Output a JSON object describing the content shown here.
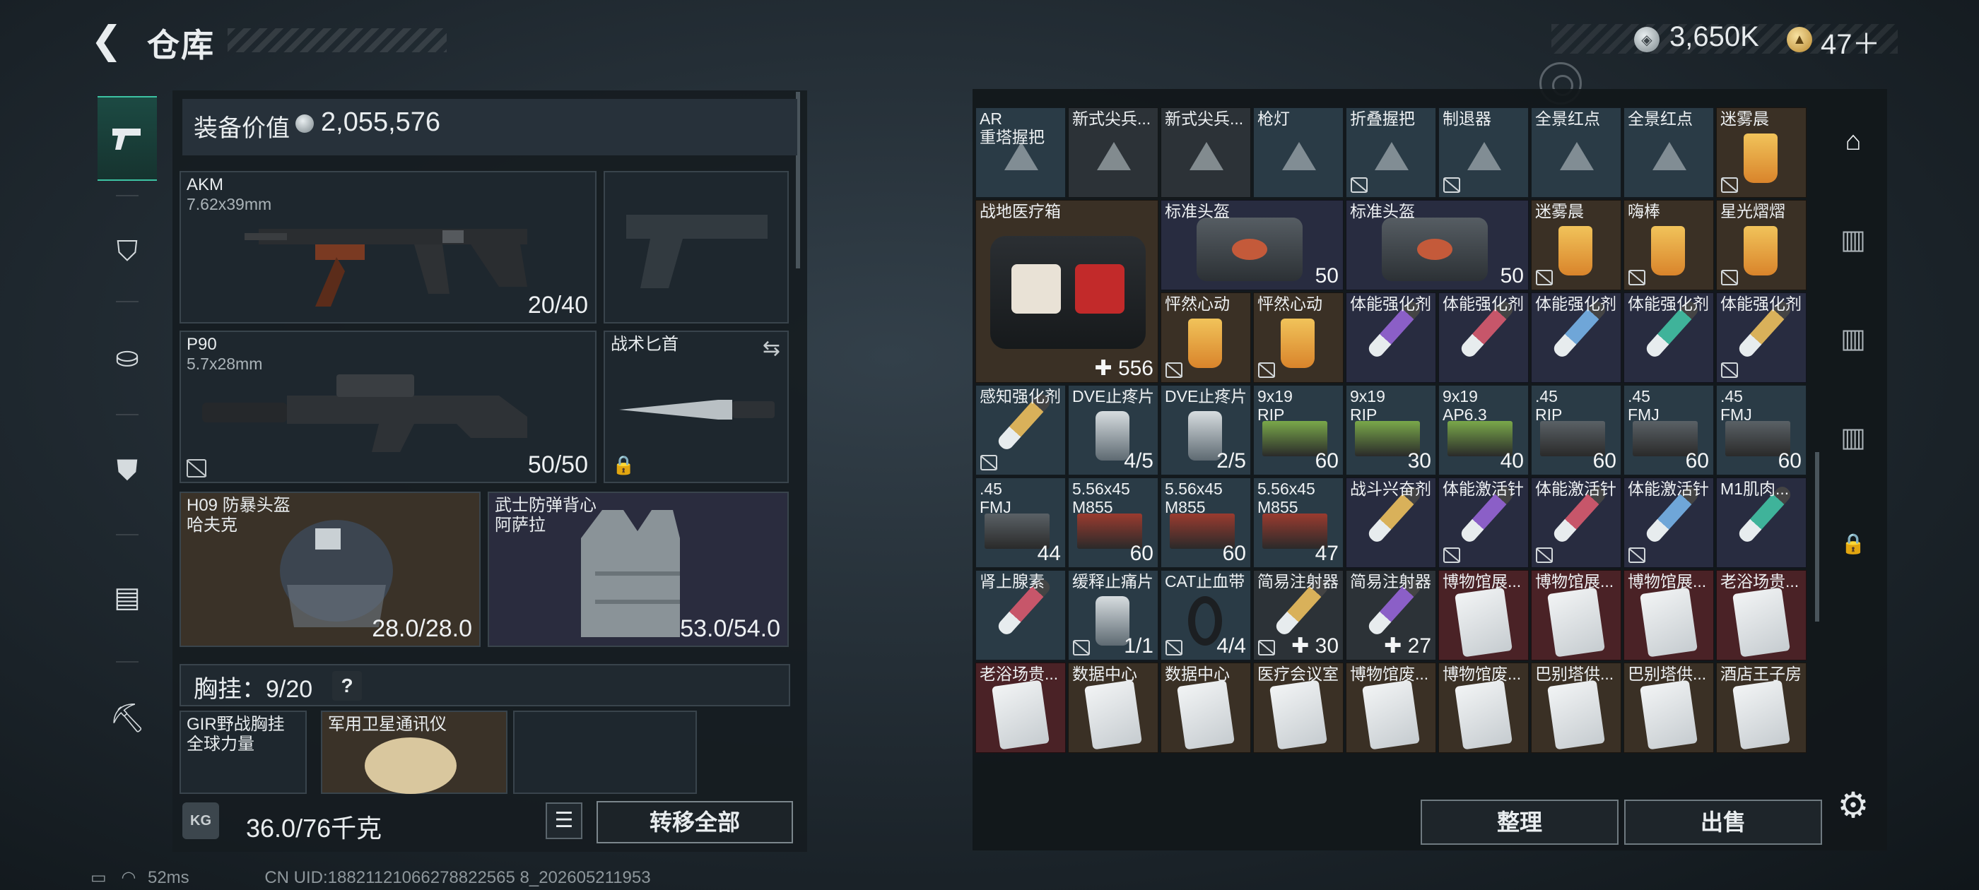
{
  "header": {
    "title": "仓库",
    "back_icon": "chevron-left-icon"
  },
  "currency": {
    "silver": "3,650K",
    "gold": "47＋",
    "plus": "+"
  },
  "sidebar": {
    "items": [
      "pistol-icon",
      "armor-icon",
      "backpack-icon",
      "chest-rig-icon",
      "case-icon",
      "toolbox-icon"
    ]
  },
  "equipment": {
    "value_label": "装备价值",
    "value": "2,055,576",
    "slots": [
      {
        "name": "AKM",
        "caliber": "7.62x39mm",
        "ammo": "20/40"
      },
      {
        "name": "",
        "ammo": ""
      },
      {
        "name": "P90",
        "caliber": "5.7x28mm",
        "ammo": "50/50"
      },
      {
        "name": "战术匕首"
      },
      {
        "name": "H09 防暴头盔\n哈夫克",
        "value": "28.0/28.0"
      },
      {
        "name": "武士防弹背心\n阿萨拉",
        "value": "53.0/54.0"
      }
    ],
    "chest_label": "胸挂：9/20",
    "chest_help": "?",
    "rig_slots": [
      {
        "name": "GIR野战胸挂\n全球力量"
      },
      {
        "name": "军用卫星通讯仪"
      }
    ]
  },
  "footer": {
    "weight": "36.0/76千克",
    "kg_label": "KG",
    "transfer_all": "转移全部"
  },
  "status": {
    "ping": "52ms",
    "uid": "CN UID:18821121066278822565 8_202605211953"
  },
  "inventory": {
    "rows": [
      [
        {
          "n": "AR\n重塔握把",
          "bg": "blue",
          "t": "tri"
        },
        {
          "n": "新式尖兵...",
          "bg": "gray",
          "t": "tri"
        },
        {
          "n": "新式尖兵...",
          "bg": "gray",
          "t": "tri"
        },
        {
          "n": "枪灯",
          "bg": "blue",
          "t": "tri"
        },
        {
          "n": "折叠握把",
          "bg": "blue",
          "t": "tri",
          "nm": 1
        },
        {
          "n": "制退器",
          "bg": "blue",
          "t": "tri",
          "nm": 1
        },
        {
          "n": "全景红点",
          "bg": "blue",
          "t": "tri"
        },
        {
          "n": "全景红点",
          "bg": "blue",
          "t": "tri"
        },
        {
          "n": "迷雾晨",
          "bg": "brown",
          "t": "cup",
          "nm": 1
        }
      ],
      [
        {
          "n": "战地医疗箱",
          "bg": "brown",
          "t": "medkit",
          "q": "✚ 556",
          "span": 2
        },
        {
          "n": "标准头盔",
          "bg": "navy",
          "t": "bag",
          "q": "50",
          "wide": 1
        },
        {
          "n": "标准头盔",
          "bg": "navy",
          "t": "bag",
          "q": "50",
          "wide": 1
        },
        {
          "n": "迷雾晨",
          "bg": "brown",
          "t": "cup",
          "nm": 1
        },
        {
          "n": "嗨棒",
          "bg": "brown",
          "t": "cup",
          "nm": 1
        },
        {
          "n": "星光熠熠",
          "bg": "brown",
          "t": "cup",
          "nm": 1
        }
      ],
      [
        {
          "n": "怦然心动",
          "bg": "brown",
          "t": "cup",
          "nm": 1
        },
        {
          "n": "怦然心动",
          "bg": "brown",
          "t": "cup",
          "nm": 1
        },
        {
          "n": "体能强化剂",
          "bg": "navy",
          "t": "syr"
        },
        {
          "n": "体能强化剂",
          "bg": "navy",
          "t": "syr"
        },
        {
          "n": "体能强化剂",
          "bg": "navy",
          "t": "syr"
        },
        {
          "n": "体能强化剂",
          "bg": "navy",
          "t": "syr"
        },
        {
          "n": "体能强化剂",
          "bg": "navy",
          "t": "syr",
          "nm": 1
        }
      ],
      [
        {
          "n": "感知强化剂",
          "bg": "blue",
          "t": "syr",
          "nm": 1
        },
        {
          "n": "DVE止疼片",
          "bg": "blue",
          "t": "pill",
          "q": "4/5"
        },
        {
          "n": "DVE止疼片",
          "bg": "blue",
          "t": "pill",
          "q": "2/5"
        },
        {
          "n": "9x19\nRIP",
          "bg": "blue",
          "t": "ammo",
          "q": "60"
        },
        {
          "n": "9x19\nRIP",
          "bg": "blue",
          "t": "ammo",
          "q": "30"
        },
        {
          "n": "9x19\nAP6.3",
          "bg": "blue",
          "t": "ammo",
          "q": "40"
        },
        {
          "n": ".45\nRIP",
          "bg": "blue",
          "t": "ammo",
          "q": "60"
        },
        {
          "n": ".45\nFMJ",
          "bg": "blue",
          "t": "ammo",
          "q": "60"
        },
        {
          "n": ".45\nFMJ",
          "bg": "blue",
          "t": "ammo",
          "q": "60"
        }
      ],
      [
        {
          "n": ".45\nFMJ",
          "bg": "blue",
          "t": "ammo",
          "q": "44"
        },
        {
          "n": "5.56x45\nM855",
          "bg": "blue",
          "t": "ammo",
          "q": "60"
        },
        {
          "n": "5.56x45\nM855",
          "bg": "blue",
          "t": "ammo",
          "q": "60"
        },
        {
          "n": "5.56x45\nM855",
          "bg": "blue",
          "t": "ammo",
          "q": "47"
        },
        {
          "n": "战斗兴奋剂",
          "bg": "navy",
          "t": "syr"
        },
        {
          "n": "体能激活针",
          "bg": "navy",
          "t": "syr",
          "nm": 1
        },
        {
          "n": "体能激活针",
          "bg": "navy",
          "t": "syr",
          "nm": 1
        },
        {
          "n": "体能激活针",
          "bg": "navy",
          "t": "syr",
          "nm": 1
        },
        {
          "n": "M1肌肉...",
          "bg": "navy",
          "t": "syr"
        }
      ],
      [
        {
          "n": "肾上腺素",
          "bg": "blue",
          "t": "syr"
        },
        {
          "n": "缓释止痛片",
          "bg": "blue",
          "t": "pill",
          "q": "1/1",
          "nm": 1
        },
        {
          "n": "CAT止血带",
          "bg": "blue",
          "t": "band",
          "q": "4/4",
          "nm": 1
        },
        {
          "n": "简易注射器",
          "bg": "gray",
          "t": "syr",
          "q": "✚ 30",
          "nm": 1
        },
        {
          "n": "简易注射器",
          "bg": "gray",
          "t": "syr",
          "q": "✚ 27"
        },
        {
          "n": "博物馆展...",
          "bg": "red",
          "t": "card"
        },
        {
          "n": "博物馆展...",
          "bg": "red",
          "t": "card"
        },
        {
          "n": "博物馆展...",
          "bg": "red",
          "t": "card"
        },
        {
          "n": "老浴场贵...",
          "bg": "red",
          "t": "card"
        }
      ],
      [
        {
          "n": "老浴场贵...",
          "bg": "red",
          "t": "card"
        },
        {
          "n": "数据中心",
          "bg": "brown",
          "t": "card"
        },
        {
          "n": "数据中心",
          "bg": "brown",
          "t": "card"
        },
        {
          "n": "医疗会议室",
          "bg": "brown",
          "t": "card"
        },
        {
          "n": "博物馆废...",
          "bg": "brown",
          "t": "card"
        },
        {
          "n": "博物馆废...",
          "bg": "brown",
          "t": "card"
        },
        {
          "n": "巴别塔供...",
          "bg": "brown",
          "t": "card"
        },
        {
          "n": "巴别塔供...",
          "bg": "brown",
          "t": "card"
        },
        {
          "n": "酒店王子房",
          "bg": "brown",
          "t": "card"
        }
      ]
    ]
  },
  "actions": {
    "sort": "整理",
    "sell": "出售"
  },
  "colors": {
    "accent": "#3dc3a3",
    "rarity_blue": "#2a3b46",
    "rarity_purple": "#282c40",
    "rarity_gold": "#3a3025",
    "rarity_red": "#4a2226"
  }
}
